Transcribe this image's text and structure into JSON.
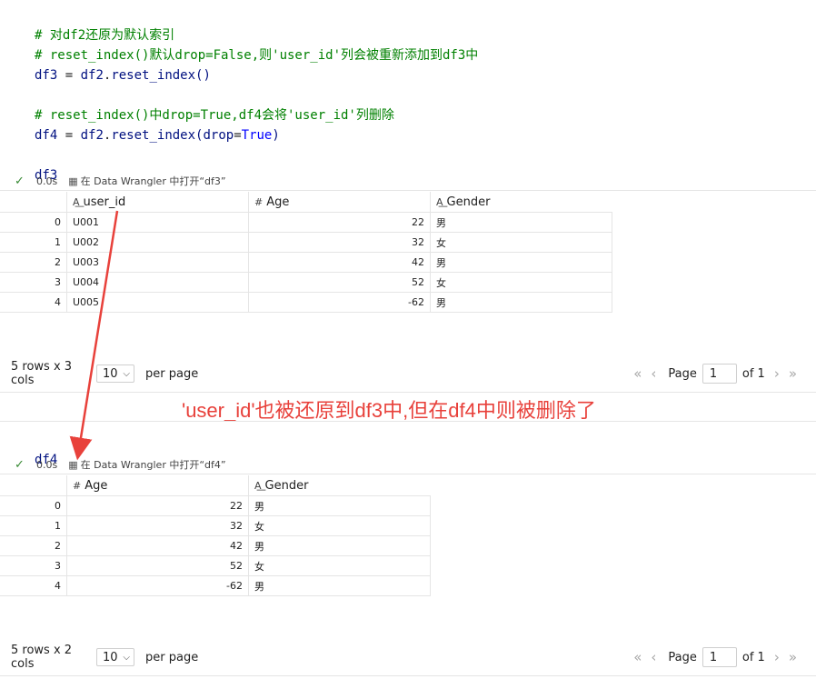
{
  "cell1": {
    "code": {
      "line1": "# 对df2还原为默认索引",
      "line2": "# reset_index()默认drop=False,则'user_id'列会被重新添加到df3中",
      "line3_var": "df3",
      "line3_eq": " = ",
      "line3_obj": "df2",
      "line3_dot": ".",
      "line3_fn": "reset_index",
      "line3_paren": "()",
      "line5": "# reset_index()中drop=True,df4会将'user_id'列删除",
      "line6_var": "df4",
      "line6_eq": " = ",
      "line6_obj": "df2",
      "line6_dot": ".",
      "line6_fn": "reset_index",
      "line6_open": "(",
      "line6_kw": "drop",
      "line6_eq2": "=",
      "line6_val": "True",
      "line6_close": ")",
      "line8": "df3"
    },
    "status": {
      "time": "0.0s",
      "link": "在 Data Wrangler 中打开“df3”"
    },
    "table": {
      "columns": [
        {
          "icon": "text-type-icon",
          "name": "user_id"
        },
        {
          "icon": "number-type-icon",
          "name": "Age"
        },
        {
          "icon": "text-type-icon",
          "name": "Gender"
        }
      ],
      "rows": [
        {
          "idx": "0",
          "user_id": "U001",
          "age": "22",
          "gender": "男"
        },
        {
          "idx": "1",
          "user_id": "U002",
          "age": "32",
          "gender": "女"
        },
        {
          "idx": "2",
          "user_id": "U003",
          "age": "42",
          "gender": "男"
        },
        {
          "idx": "3",
          "user_id": "U004",
          "age": "52",
          "gender": "女"
        },
        {
          "idx": "4",
          "user_id": "U005",
          "age": "-62",
          "gender": "男"
        }
      ]
    },
    "footer": {
      "summary": "5 rows x 3 cols",
      "page_size": "10",
      "per_page": "per page",
      "page_label": "Page",
      "page": "1",
      "of": "of 1"
    }
  },
  "annotation": "'user_id'也被还原到df3中,但在df4中则被删除了",
  "cell2": {
    "code": {
      "line1": "df4"
    },
    "status": {
      "time": "0.0s",
      "link": "在 Data Wrangler 中打开“df4”"
    },
    "table": {
      "columns": [
        {
          "icon": "number-type-icon",
          "name": "Age"
        },
        {
          "icon": "text-type-icon",
          "name": "Gender"
        }
      ],
      "rows": [
        {
          "idx": "0",
          "age": "22",
          "gender": "男"
        },
        {
          "idx": "1",
          "age": "32",
          "gender": "女"
        },
        {
          "idx": "2",
          "age": "42",
          "gender": "男"
        },
        {
          "idx": "3",
          "age": "52",
          "gender": "女"
        },
        {
          "idx": "4",
          "age": "-62",
          "gender": "男"
        }
      ]
    },
    "footer": {
      "summary": "5 rows x 2 cols",
      "page_size": "10",
      "per_page": "per page",
      "page_label": "Page",
      "page": "1",
      "of": "of 1"
    }
  },
  "icons": {
    "check": "✓",
    "first": "«",
    "prev": "‹",
    "next": "›",
    "last": "»",
    "chevron": "⌵",
    "text_type": "A͟",
    "number_type": "#",
    "wrangler": "▦"
  },
  "colors": {
    "comment": "#008000",
    "annotation": "#e8413b",
    "check": "#388a34"
  }
}
